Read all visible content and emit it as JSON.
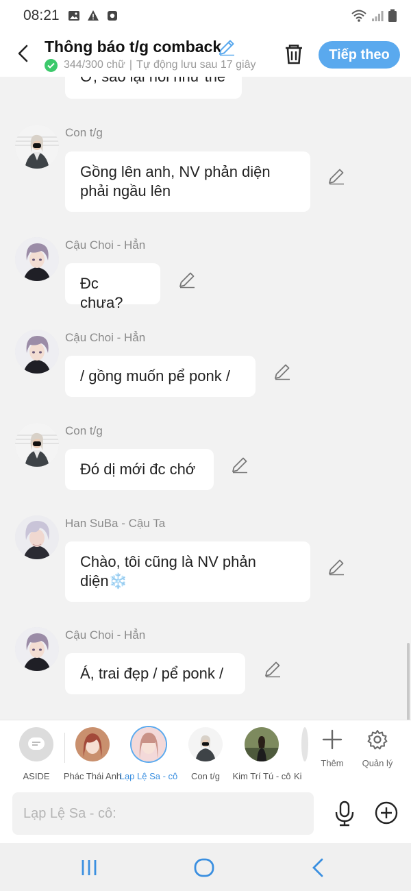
{
  "status_bar": {
    "time": "08:21"
  },
  "header": {
    "title": "Thông báo t/g comback",
    "word_count": "344/300 chữ",
    "separator": "|",
    "autosave": "Tự động lưu sau 17 giây",
    "next_label": "Tiếp theo"
  },
  "messages": [
    {
      "sender": "",
      "text": "Ơ, sao lại nói như thế"
    },
    {
      "sender": "Con t/g",
      "text": "Gồng lên anh, NV phản diện phải ngầu lên"
    },
    {
      "sender": "Cậu Choi - Hẳn",
      "text": "Đc chưa?"
    },
    {
      "sender": "Cậu Choi - Hẳn",
      "text": "/ gồng muốn pể ponk /"
    },
    {
      "sender": "Con t/g",
      "text": "Đó dị mới đc chớ"
    },
    {
      "sender": "Han SuBa - Cậu Ta",
      "text": "Chào, tôi cũng là NV phản diện❄️"
    },
    {
      "sender": "Cậu Choi - Hẳn",
      "text": "Á, trai đẹp / pể ponk /"
    }
  ],
  "characters": [
    {
      "label": "ASIDE",
      "icon": "aside-icon"
    },
    {
      "label": "Phác Thái Anh"
    },
    {
      "label": "Lạp Lệ Sa - cô"
    },
    {
      "label": "Con t/g"
    },
    {
      "label": "Kim Trí Tú - cô"
    },
    {
      "label": "Ki"
    }
  ],
  "tools": {
    "add_label": "Thêm",
    "manage_label": "Quản lý"
  },
  "input": {
    "placeholder": "Lạp Lệ Sa - cô:"
  },
  "colors": {
    "accent": "#5aa9ee",
    "check": "#3cc96b",
    "background": "#f2f2f2"
  }
}
